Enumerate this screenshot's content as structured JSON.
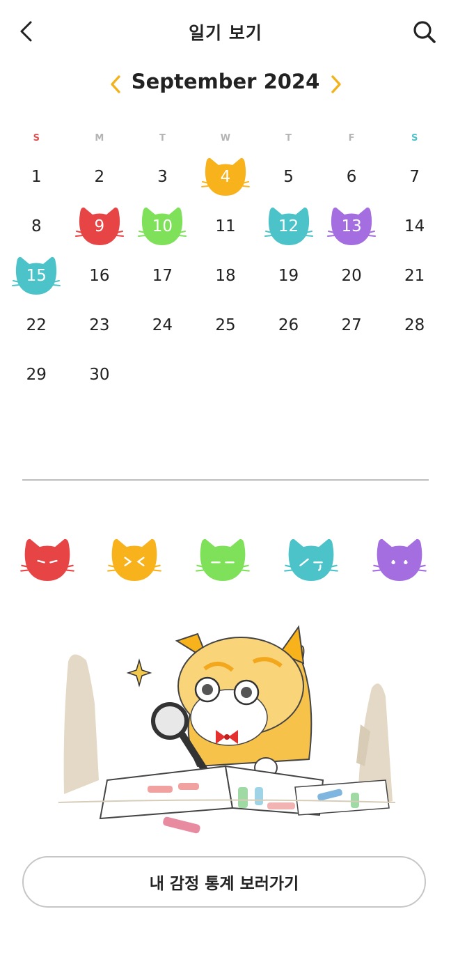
{
  "header": {
    "title": "일기 보기",
    "back_icon": "chevron-left-icon",
    "search_icon": "search-icon"
  },
  "calendar": {
    "month_label": "September 2024",
    "prev_icon": "chevron-left-icon",
    "next_icon": "chevron-right-icon",
    "arrow_color": "#f2b21c",
    "weekdays": [
      "S",
      "M",
      "T",
      "W",
      "T",
      "F",
      "S"
    ],
    "weekday_colors": {
      "sunday": "#e05151",
      "saturday": "#4cc3c9",
      "default": "#b5b5b5"
    },
    "first_weekday_index": 0,
    "days_in_month": 30,
    "entries": [
      {
        "day": 4,
        "mood": "orange"
      },
      {
        "day": 9,
        "mood": "red"
      },
      {
        "day": 10,
        "mood": "green"
      },
      {
        "day": 12,
        "mood": "teal"
      },
      {
        "day": 13,
        "mood": "purple"
      },
      {
        "day": 15,
        "mood": "teal"
      }
    ]
  },
  "mood_colors": {
    "red": "#e74545",
    "orange": "#f7b21c",
    "green": "#7fe05a",
    "teal": "#4cc3c9",
    "purple": "#a46ee0"
  },
  "emotions": [
    {
      "mood": "red",
      "icon": "angry-cat-icon"
    },
    {
      "mood": "orange",
      "icon": "excited-cat-icon"
    },
    {
      "mood": "green",
      "icon": "calm-cat-icon"
    },
    {
      "mood": "teal",
      "icon": "sad-cat-icon"
    },
    {
      "mood": "purple",
      "icon": "anxious-cat-icon"
    }
  ],
  "illustration": {
    "icon": "cat-with-magnifying-glass-illustration"
  },
  "stats_button": {
    "label": "내 감정 통계 보러가기"
  }
}
